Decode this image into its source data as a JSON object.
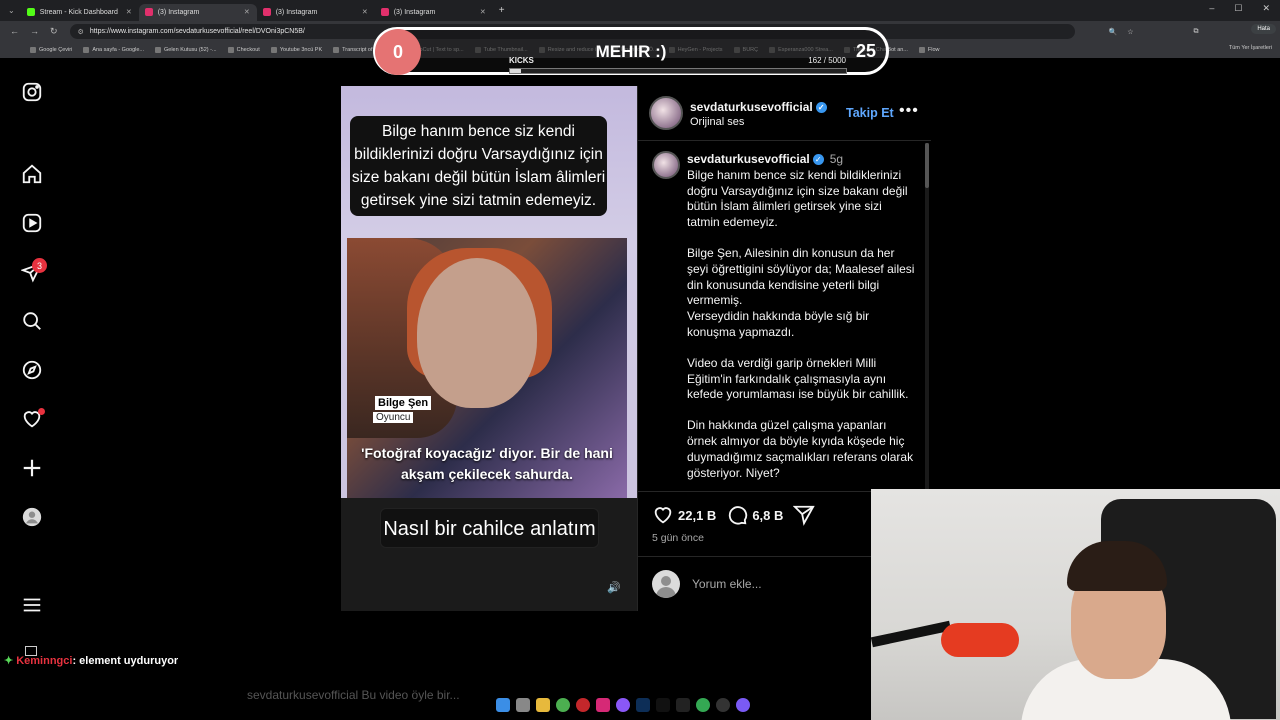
{
  "browser": {
    "tabs": [
      {
        "label": "Stream - Kick Dashboard",
        "color": "#53fc18",
        "active": false
      },
      {
        "label": "(3) Instagram",
        "color": "#e1306c",
        "active": true
      },
      {
        "label": "(3) Instagram",
        "color": "#e1306c",
        "active": false
      },
      {
        "label": "(3) Instagram",
        "color": "#e1306c",
        "active": false
      }
    ],
    "url": "https://www.instagram.com/sevdaturkusevofficial/reel/DVOni3pCN5B/",
    "profile_label": "Hata",
    "bookmarks": [
      "Google Çeviri",
      "Ana sayfa - Google...",
      "Gelen Kutusu (52) -...",
      "Checkout",
      "Youtube 3ncü PK",
      "Transcript of \"Mi M...",
      "CapCut | Text to sp...",
      "Tube Thumbnail...",
      "Resize and reduce i...",
      "İspanyolca Ö...",
      "HeyGen - Projects",
      "BURÇ",
      "Esperanza000 Strea...",
      "The best ChatBot an...",
      "Flow"
    ],
    "all_bookmarks": "Tüm Yer İşaretleri"
  },
  "overlay": {
    "left_score": "0",
    "name": "MEHIR :)",
    "right_score": "25",
    "kicks_label": "KICKS",
    "kicks_count": "162 / 5000",
    "kicks_progress": 0.032
  },
  "sidebar": {
    "notifications_badge": "3"
  },
  "reel": {
    "top_caption": "Bilge hanım bence siz kendi bildiklerinizi doğru Varsaydığınız için size bakanı değil bütün İslam âlimleri getirsek yine sizi tatmin edemeyiz.",
    "name_tag": "Bilge Şen",
    "role_tag": "Oyuncu",
    "subtitle": "'Fotoğraf koyacağız' diyor. Bir de hani akşam çekilecek sahurda.",
    "bottom_caption": "Nasıl bir cahilce anlatım"
  },
  "post": {
    "username": "sevdaturkusevofficial",
    "audio": "Orijinal ses",
    "follow_label": "Takip Et",
    "time_short": "5g",
    "paragraphs": [
      "Bilge hanım bence siz kendi bildiklerinizi doğru Varsaydığınız için size bakanı değil bütün İslam âlimleri getirsek yine sizi tatmin edemeyiz.",
      "Bilge Şen, Ailesinin din konusun da her şeyi öğrettigini söylüyor da; Maalesef ailesi din konusunda kendisine yeterli bilgi vermemiş.\nVerseydidin hakkında böyle sığ bir konuşma yapmazdı.",
      "Video da  verdiği garip örnekleri Milli Eğitim'in  farkındalık çalışmasıyla aynı kefede yorumlaması ise büyük bir cahillik.",
      "Din hakkında güzel çalışma yapanları örnek almıyor da böyle kıyıda köşede hiç duymadığımız saçmalıkları referans olarak gösteriyor. Niyet?"
    ],
    "likes": "22,1 B",
    "comments": "6,8 B",
    "time_ago": "5 gün önce",
    "comment_placeholder": "Yorum ekle..."
  },
  "chat": {
    "user": "Keminngci",
    "message": ": element uyduruyor"
  },
  "ghost_text": "sevdaturkusevofficial Bu video öyle bir..."
}
